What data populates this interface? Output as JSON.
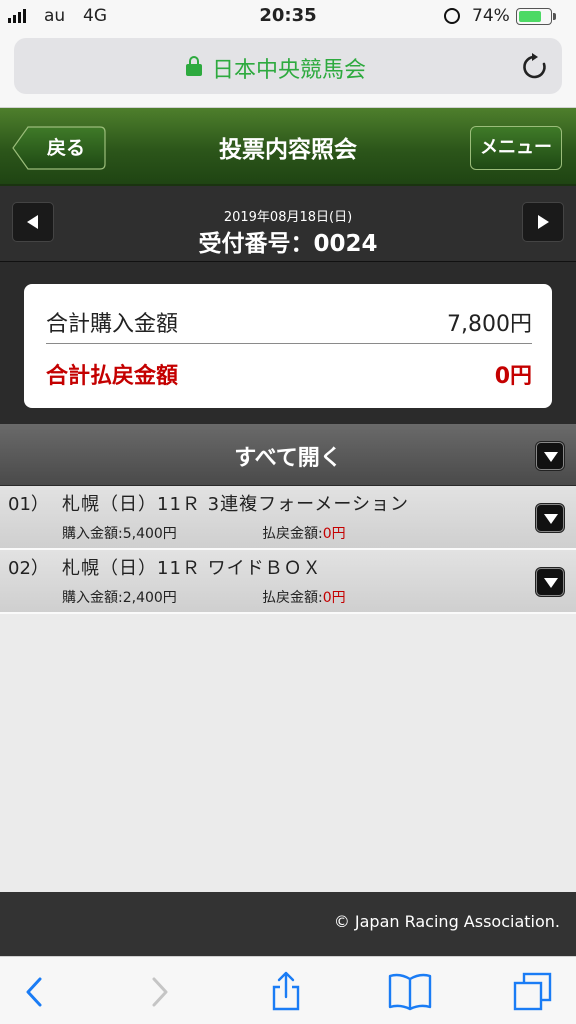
{
  "status_bar": {
    "carrier": "au",
    "network": "4G",
    "time": "20:35",
    "battery": "74%",
    "battery_level": 0.74
  },
  "browser": {
    "site_title": "日本中央競馬会"
  },
  "header": {
    "back_label": "戻る",
    "title": "投票内容照会",
    "menu_label": "メニュー"
  },
  "receipt": {
    "date": "2019年08月18日(日)",
    "number": "受付番号：0024"
  },
  "summary": {
    "total_purchase_label": "合計購入金額",
    "total_purchase_value": "7,800円",
    "total_refund_label": "合計払戻金額",
    "total_refund_value": "0円"
  },
  "expand_all_label": "すべて開く",
  "bets": [
    {
      "num": "01）",
      "desc": "札幌（日）11Ｒ 3連複フォーメーション",
      "buy": "購入金額:5,400円",
      "pay_label": "払戻金額:",
      "pay_value": "0円"
    },
    {
      "num": "02）",
      "desc": "札幌（日）11Ｒ ワイドＢＯＸ",
      "buy": "購入金額:2,400円",
      "pay_label": "払戻金額:",
      "pay_value": "0円"
    }
  ],
  "footer": {
    "copyright": "© Japan Racing Association."
  },
  "colors": {
    "green_header": "#2c561a",
    "refund_red": "#c40000",
    "secure_green": "#2eaa3f",
    "ios_blue": "#1a7cf5"
  }
}
